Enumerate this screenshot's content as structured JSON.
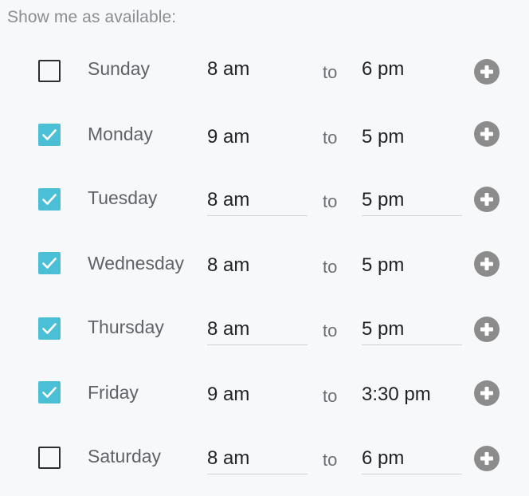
{
  "heading": "Show me as available:",
  "colors": {
    "checked": "#4bbfd6",
    "add_icon": "#8c8c8c"
  },
  "days": [
    {
      "name": "Sunday",
      "checked": false,
      "start": "8 am",
      "end": "6 pm",
      "to": "to",
      "icon": "plus-circle-icon"
    },
    {
      "name": "Monday",
      "checked": true,
      "start": "9 am",
      "end": "5 pm",
      "to": "to",
      "icon": "plus-circle-icon"
    },
    {
      "name": "Tuesday",
      "checked": true,
      "start": "8 am",
      "end": "5 pm",
      "to": "to",
      "icon": "plus-circle-icon"
    },
    {
      "name": "Wednesday",
      "checked": true,
      "start": "8 am",
      "end": "5 pm",
      "to": "to",
      "icon": "plus-circle-icon"
    },
    {
      "name": "Thursday",
      "checked": true,
      "start": "8 am",
      "end": "5 pm",
      "to": "to",
      "icon": "plus-circle-icon"
    },
    {
      "name": "Friday",
      "checked": true,
      "start": "9 am",
      "end": "3:30 pm",
      "to": "to",
      "icon": "plus-circle-icon"
    },
    {
      "name": "Saturday",
      "checked": false,
      "start": "8 am",
      "end": "6 pm",
      "to": "to",
      "icon": "plus-circle-icon"
    }
  ]
}
